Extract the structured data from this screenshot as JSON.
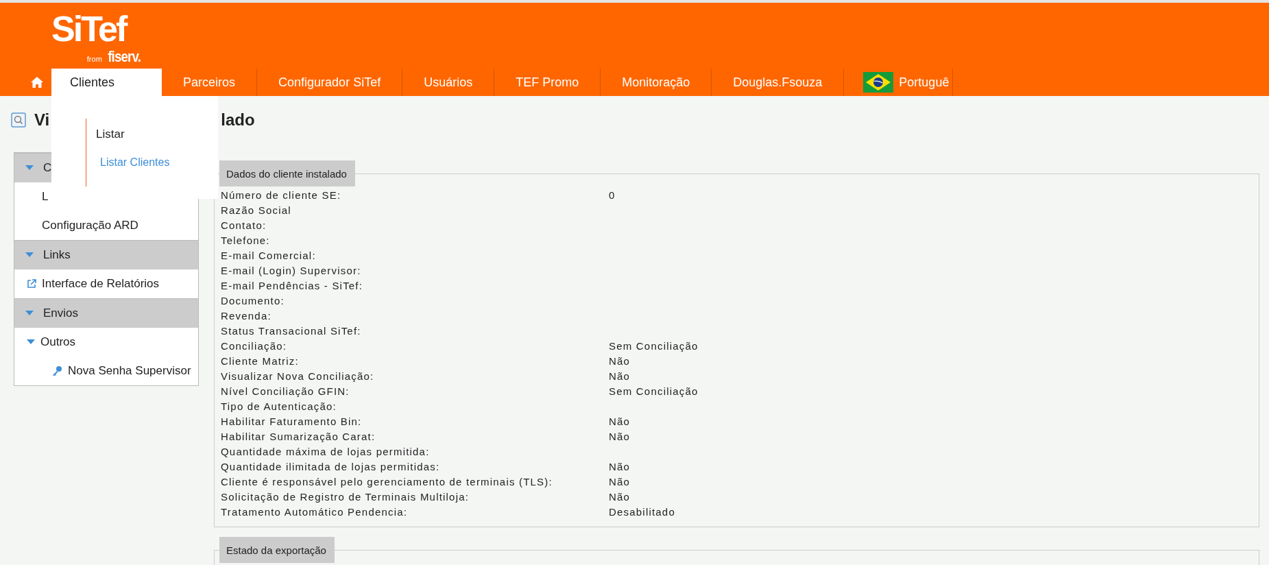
{
  "header": {
    "logo": {
      "brand": "SiTef",
      "from": "from",
      "partner": "fiserv."
    }
  },
  "nav": {
    "tabs": [
      {
        "label": "Clientes",
        "selected": true
      },
      {
        "label": "Parceiros",
        "selected": false
      },
      {
        "label": "Configurador SiTef",
        "selected": false
      },
      {
        "label": "Usuários",
        "selected": false
      },
      {
        "label": "TEF Promo",
        "selected": false
      },
      {
        "label": "Monitoração",
        "selected": false
      },
      {
        "label": "Douglas.Fsouza",
        "selected": false
      }
    ],
    "language": {
      "label": "Portuguê"
    }
  },
  "dropdown": {
    "heading": "Listar",
    "items": [
      {
        "label": "Listar Clientes"
      }
    ]
  },
  "page_title_parts": [
    "Vi",
    "lado"
  ],
  "sidebar": {
    "sections": [
      {
        "title": "C",
        "expanded": true,
        "items": [
          {
            "label": "L",
            "kind": "text"
          },
          {
            "label": "Configuração ARD",
            "kind": "text"
          }
        ]
      },
      {
        "title": "Links",
        "expanded": true,
        "items": [
          {
            "label": "Interface de Relatórios",
            "kind": "external-link"
          }
        ]
      },
      {
        "title": "Envios",
        "expanded": true,
        "items": [
          {
            "label": "Outros",
            "kind": "group",
            "expanded": true,
            "children": [
              {
                "label": "Nova Senha Supervisor",
                "kind": "key"
              }
            ]
          }
        ]
      }
    ]
  },
  "fieldsets": [
    {
      "legend": "Dados do cliente instalado",
      "rows": [
        {
          "label": "Número de cliente SE:",
          "value": "0"
        },
        {
          "label": "Razão Social"
        },
        {
          "label": "Contato:"
        },
        {
          "label": "Telefone:"
        },
        {
          "label": "E-mail Comercial:"
        },
        {
          "label": "E-mail (Login) Supervisor:"
        },
        {
          "label": "E-mail Pendências - SiTef:"
        },
        {
          "label": "Documento:"
        },
        {
          "label": "Revenda:"
        },
        {
          "label": "Status Transacional SiTef:"
        },
        {
          "label": "Conciliação:",
          "value": "Sem Conciliação"
        },
        {
          "label": "Cliente Matriz:",
          "value": "Não"
        },
        {
          "label": "Visualizar Nova Conciliação:",
          "value": "Não"
        },
        {
          "label": "Nível Conciliação GFIN:",
          "value": "Sem Conciliação"
        },
        {
          "label": "Tipo de Autenticação:"
        },
        {
          "label": "Habilitar Faturamento Bin:",
          "value": "Não"
        },
        {
          "label": "Habilitar Sumarização Carat:",
          "value": "Não"
        },
        {
          "label": "Quantidade máxima de lojas permitida:"
        },
        {
          "label": "Quantidade ilimitada de lojas permitidas:",
          "value": "Não"
        },
        {
          "label": "Cliente é responsável pelo gerenciamento de terminais (TLS):",
          "value": "Não"
        },
        {
          "label": "Solicitação de Registro de Terminais Multiloja:",
          "value": "Não"
        },
        {
          "label": "Tratamento Automático Pendencia:",
          "value": "Desabilitado"
        }
      ]
    },
    {
      "legend": "Estado da exportação"
    }
  ]
}
